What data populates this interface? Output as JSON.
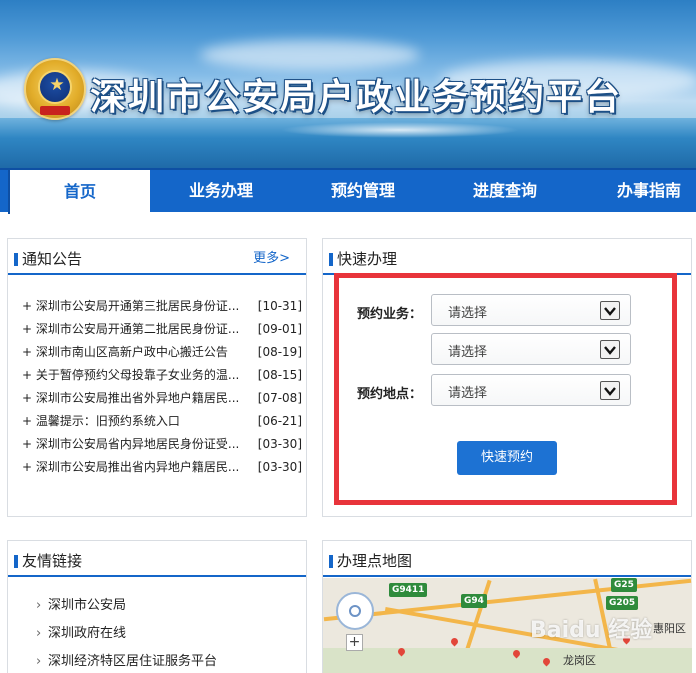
{
  "site_title": "深圳市公安局户政业务预约平台",
  "nav": {
    "items": [
      {
        "label": "首页",
        "active": true
      },
      {
        "label": "业务办理",
        "active": false
      },
      {
        "label": "预约管理",
        "active": false
      },
      {
        "label": "进度查询",
        "active": false
      },
      {
        "label": "办事指南",
        "active": false
      }
    ]
  },
  "notices": {
    "title": "通知公告",
    "more_label": "更多>",
    "items": [
      {
        "title": "深圳市公安局开通第三批居民身份证...",
        "date": "[10-31]"
      },
      {
        "title": "深圳市公安局开通第二批居民身份证...",
        "date": "[09-01]"
      },
      {
        "title": "深圳市南山区高新户政中心搬迁公告",
        "date": "[08-19]"
      },
      {
        "title": "关于暂停预约父母投靠子女业务的温...",
        "date": "[08-15]"
      },
      {
        "title": "深圳市公安局推出省外异地户籍居民...",
        "date": "[07-08]"
      },
      {
        "title": "温馨提示：旧预约系统入口",
        "date": "[06-21]"
      },
      {
        "title": "深圳市公安局省内异地居民身份证受...",
        "date": "[03-30]"
      },
      {
        "title": "深圳市公安局推出省内异地户籍居民...",
        "date": "[03-30]"
      }
    ]
  },
  "quick": {
    "title": "快速办理",
    "business_label": "预约业务：",
    "location_label": "预约地点：",
    "select_placeholder": "请选择",
    "button_label": "快速预约",
    "highlight_color": "#e8343b"
  },
  "links": {
    "title": "友情链接",
    "items": [
      "深圳市公安局",
      "深圳政府在线",
      "深圳经济特区居住证服务平台"
    ]
  },
  "map": {
    "title": "办理点地图",
    "labels": [
      "G9411",
      "G94",
      "G205",
      "G25",
      "惠阳区",
      "龙岗区"
    ],
    "watermark": "Baidu 经验"
  },
  "colors": {
    "primary": "#1466c9",
    "button": "#1d72d3"
  }
}
